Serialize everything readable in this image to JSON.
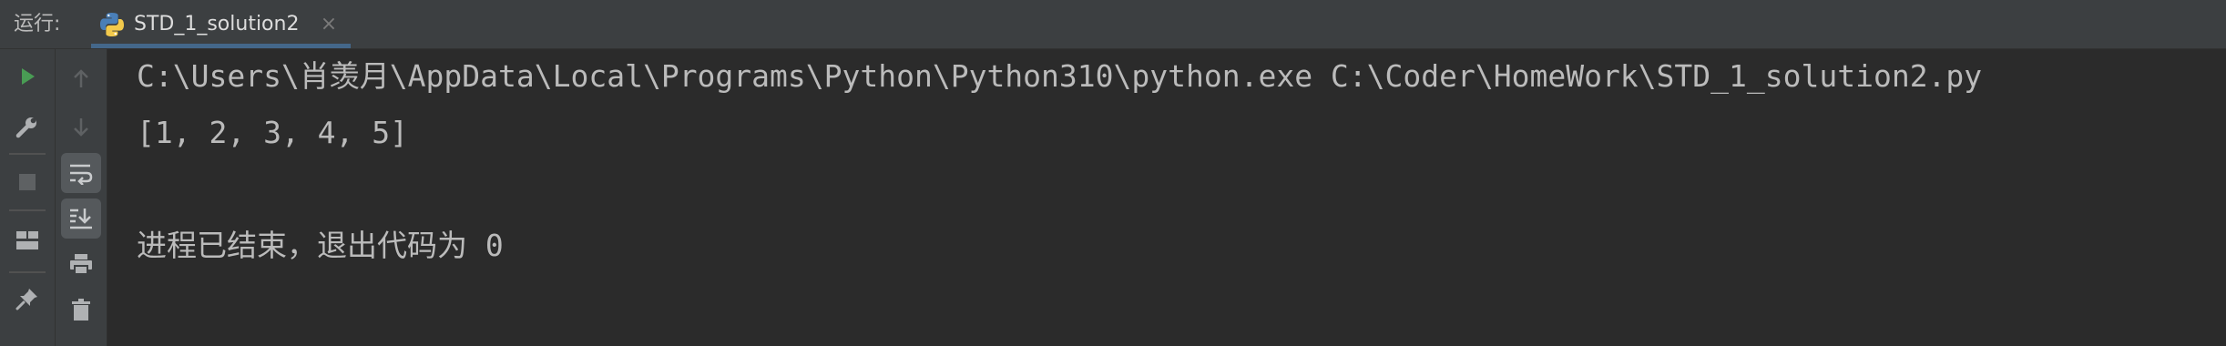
{
  "run_panel": {
    "label": "运行:",
    "tab": {
      "title": "STD_1_solution2",
      "close_symbol": "×",
      "icon": "python-icon"
    }
  },
  "toolbar_main": {
    "buttons": [
      {
        "name": "rerun-button",
        "icon": "play-icon"
      },
      {
        "name": "edit-config-button",
        "icon": "wrench-icon"
      },
      {
        "name": "stop-button",
        "icon": "stop-icon"
      },
      {
        "name": "layout-button",
        "icon": "layout-icon"
      },
      {
        "name": "pin-tab-button",
        "icon": "pin-icon"
      }
    ]
  },
  "toolbar_secondary": {
    "buttons": [
      {
        "name": "scroll-up-button",
        "icon": "arrow-up-icon"
      },
      {
        "name": "scroll-down-button",
        "icon": "arrow-down-icon"
      },
      {
        "name": "soft-wrap-button",
        "icon": "soft-wrap-icon"
      },
      {
        "name": "scroll-to-end-button",
        "icon": "scroll-to-end-icon"
      },
      {
        "name": "print-button",
        "icon": "print-icon"
      },
      {
        "name": "clear-button",
        "icon": "trash-icon"
      }
    ]
  },
  "console": {
    "lines": [
      "C:\\Users\\肖羡月\\AppData\\Local\\Programs\\Python\\Python310\\python.exe C:\\Coder\\HomeWork\\STD_1_solution2.py",
      "[1, 2, 3, 4, 5]",
      "",
      "进程已结束，退出代码为 0"
    ]
  },
  "colors": {
    "background": "#2b2b2b",
    "toolbar": "#3c3f41",
    "text": "#bbbbbb",
    "run_green": "#499c54",
    "tab_underline": "#4a88c7"
  }
}
